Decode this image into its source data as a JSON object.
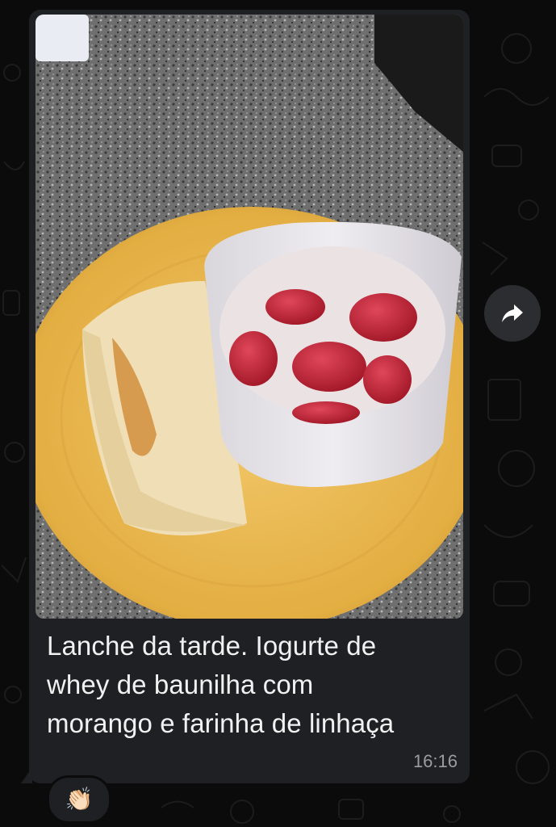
{
  "message": {
    "caption": "Lanche da tarde. Iogurte de whey de baunilha com morango e farinha de linhaça",
    "caption_lines": [
      "Lanche da tarde. Iogurte de",
      "whey de baunilha com",
      "morango e farinha de linhaça"
    ],
    "time": "16:16",
    "reaction_emoji": "👏🏻"
  },
  "icons": {
    "forward": "forward-arrow-icon",
    "reaction": "clapping-hands-icon"
  },
  "colors": {
    "bubble_background": "#1f2023",
    "caption_text": "#f1f1f1",
    "timestamp_text": "#9a9ca0",
    "chat_background": "#0b0b0b"
  }
}
